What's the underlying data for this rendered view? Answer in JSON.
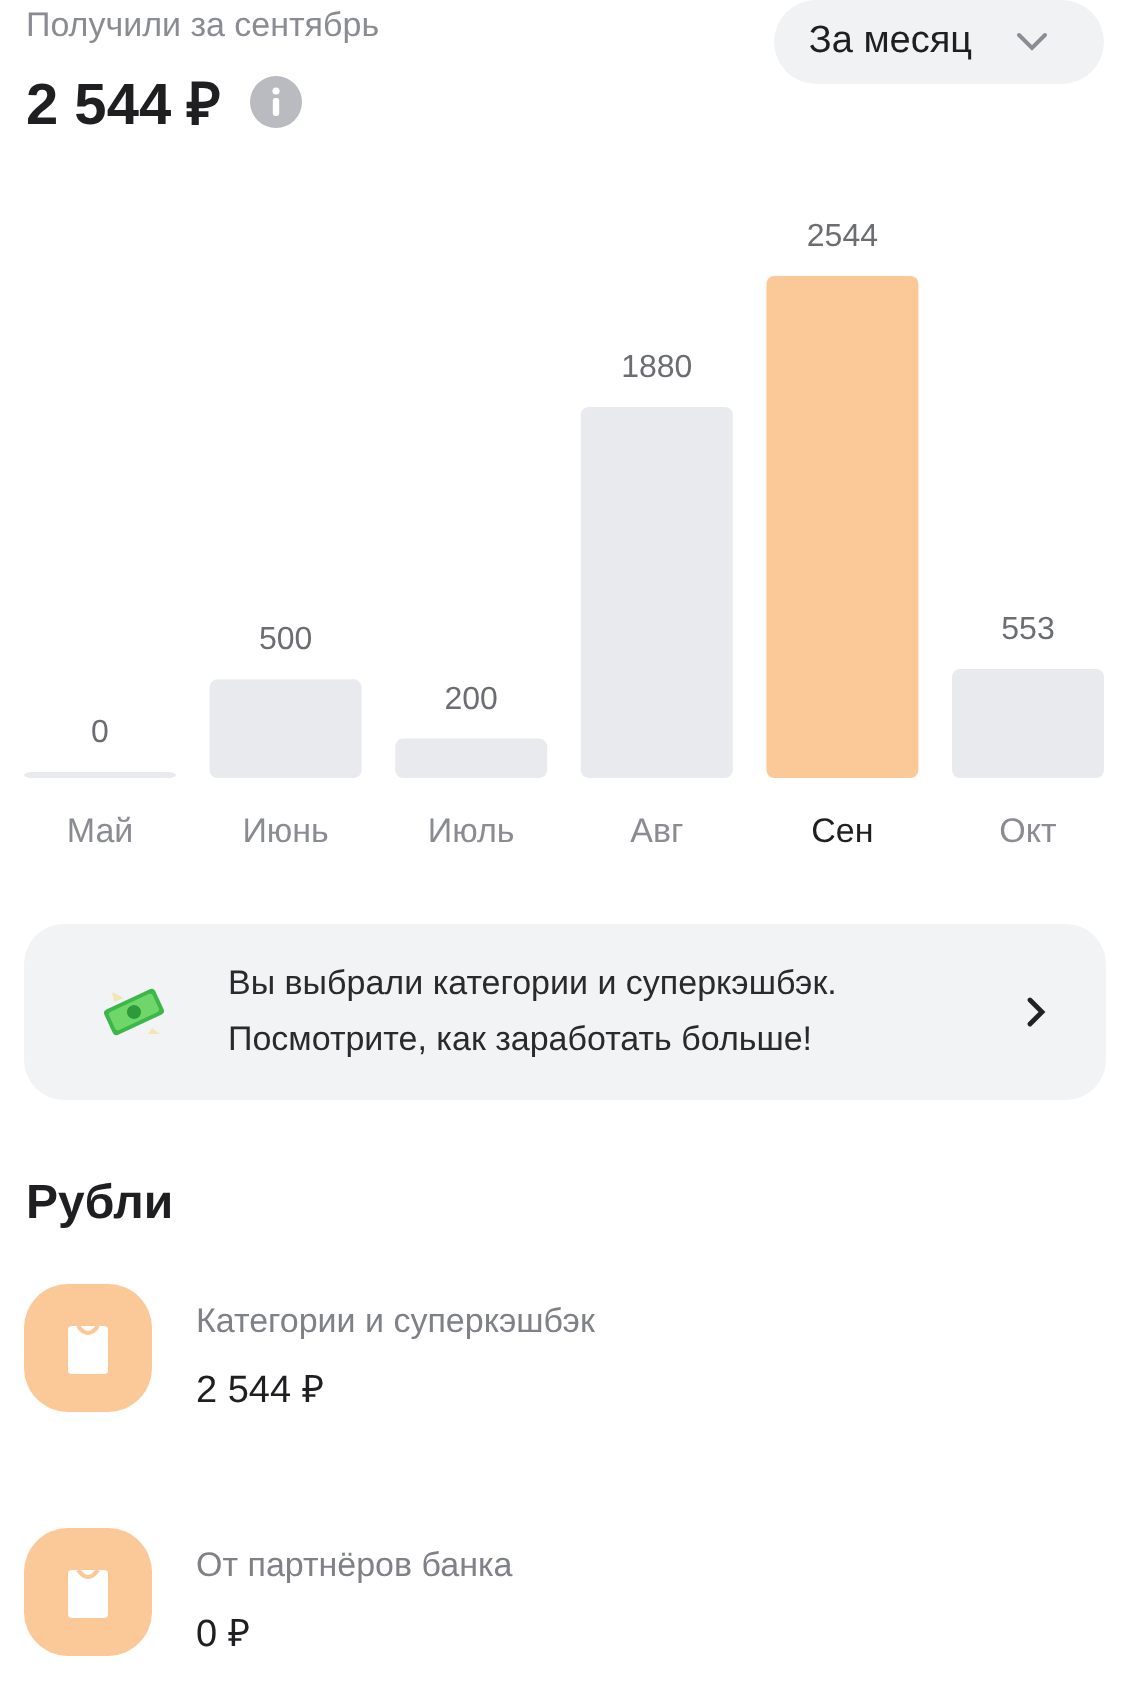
{
  "header": {
    "label": "Получили за сентябрь",
    "amount": "2 544 ₽",
    "period": "За месяц"
  },
  "chart_data": {
    "type": "bar",
    "categories": [
      "Май",
      "Июнь",
      "Июль",
      "Авг",
      "Сен",
      "Окт"
    ],
    "series": [
      {
        "color": "#e9eaee",
        "values": [
          0,
          500,
          200,
          1880,
          null,
          553
        ]
      },
      {
        "color": "#fbc898",
        "values": [
          null,
          null,
          null,
          null,
          2544,
          null
        ]
      }
    ],
    "stacked": true,
    "data_labels": true
  },
  "banner": {
    "text": "Вы выбрали категории и суперкэшбэк. Посмотрите, как заработать больше!"
  },
  "section": {
    "title": "Рубли",
    "items": [
      {
        "title": "Категории и суперкэшбэк",
        "amount": "2 544 ₽"
      },
      {
        "title": "От партнёров банка",
        "amount": "0 ₽"
      }
    ]
  }
}
